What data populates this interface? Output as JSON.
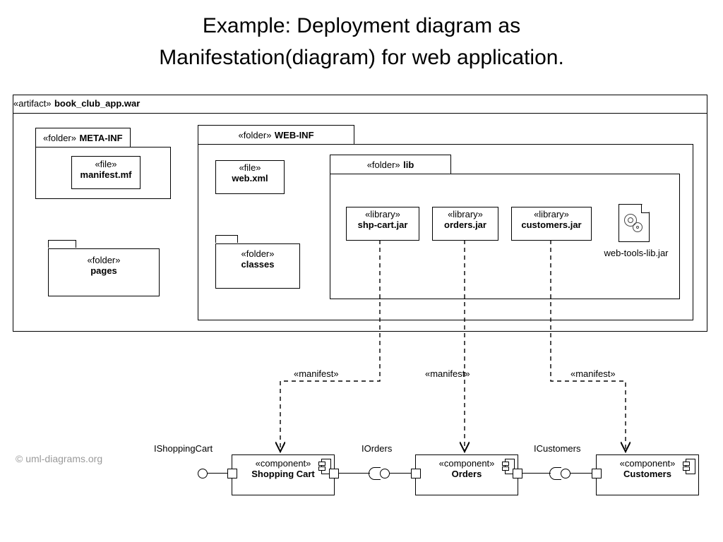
{
  "title_line1": "Example: Deployment diagram as",
  "title_line2": "Manifestation(diagram) for web application.",
  "artifact": {
    "stereotype": "«artifact»",
    "name": "book_club_app.war"
  },
  "meta_inf": {
    "stereotype": "«folder»",
    "name": "META-INF",
    "file": {
      "stereotype": "«file»",
      "name": "manifest.mf"
    }
  },
  "pages": {
    "stereotype": "«folder»",
    "name": "pages"
  },
  "web_inf": {
    "stereotype": "«folder»",
    "name": "WEB-INF",
    "webxml": {
      "stereotype": "«file»",
      "name": "web.xml"
    },
    "classes": {
      "stereotype": "«folder»",
      "name": "classes"
    },
    "lib": {
      "stereotype": "«folder»",
      "name": "lib",
      "shp": {
        "stereotype": "«library»",
        "name": "shp-cart.jar"
      },
      "orders": {
        "stereotype": "«library»",
        "name": "orders.jar"
      },
      "customers": {
        "stereotype": "«library»",
        "name": "customers.jar"
      },
      "webtools": "web-tools-lib.jar"
    }
  },
  "manifest_label": "«manifest»",
  "components": {
    "stereotype": "«component»",
    "cart": {
      "name": "Shopping Cart",
      "iface": "IShoppingCart"
    },
    "orders": {
      "name": "Orders",
      "iface": "IOrders"
    },
    "customers": {
      "name": "Customers",
      "iface": "ICustomers"
    }
  },
  "copyright": "© uml-diagrams.org"
}
